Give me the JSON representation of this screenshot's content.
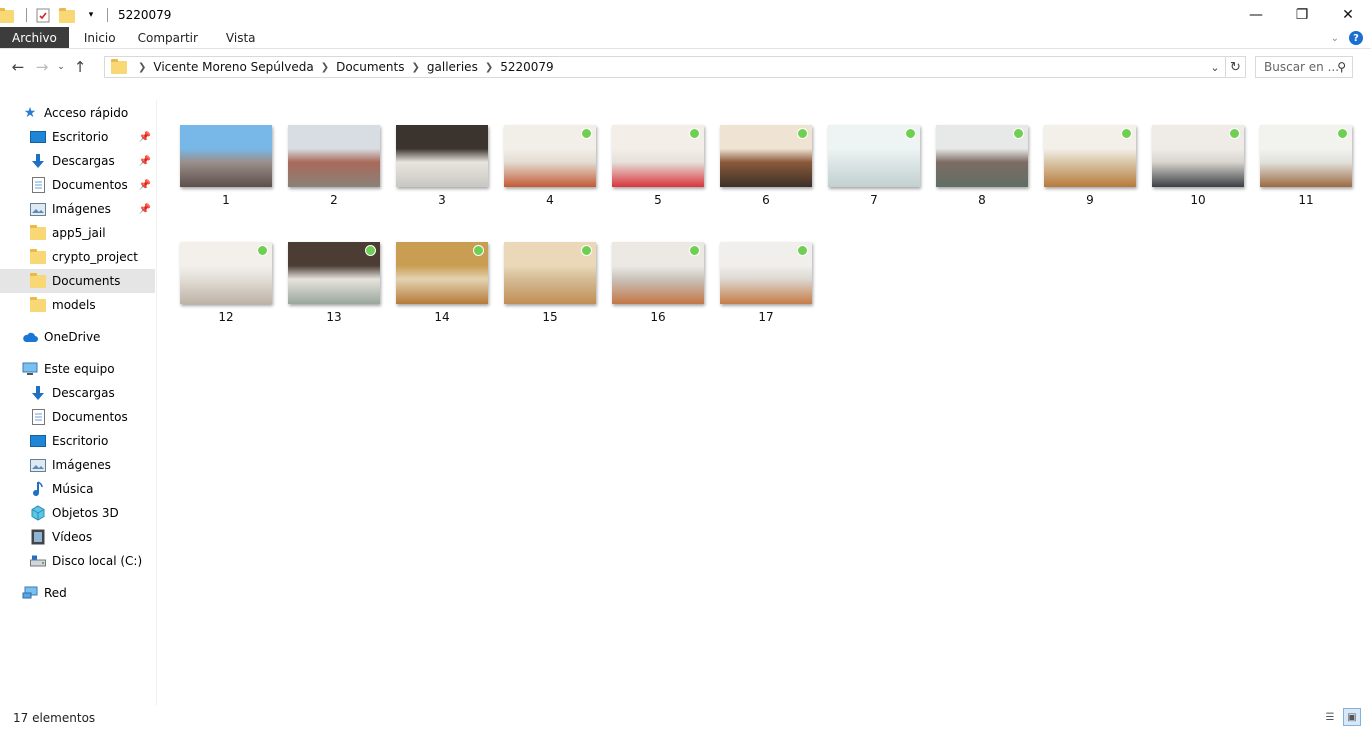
{
  "window": {
    "title": "5220079",
    "controls": {
      "minimize": "—",
      "maximize": "❐",
      "close": "✕"
    }
  },
  "ribbon": {
    "tabs": [
      "Archivo",
      "Inicio",
      "Compartir",
      "Vista"
    ],
    "help": "?"
  },
  "address": {
    "crumbs": [
      "Vicente Moreno Sepúlveda",
      "Documents",
      "galleries",
      "5220079"
    ]
  },
  "search": {
    "placeholder": "Buscar en ..."
  },
  "nav": {
    "quick_access": "Acceso rápido",
    "quick_items": [
      "Escritorio",
      "Descargas",
      "Documentos",
      "Imágenes",
      "app5_jail",
      "crypto_project",
      "Documents",
      "models"
    ],
    "onedrive": "OneDrive",
    "this_pc": "Este equipo",
    "pc_items": [
      "Descargas",
      "Documentos",
      "Escritorio",
      "Imágenes",
      "Música",
      "Objetos 3D",
      "Vídeos",
      "Disco local (C:)"
    ],
    "network": "Red"
  },
  "files": [
    {
      "label": "1",
      "colors": [
        "#78b8e8",
        "#9a8f8a",
        "#5d4f4b"
      ],
      "badge": false
    },
    {
      "label": "2",
      "colors": [
        "#d7dde3",
        "#a86a5a",
        "#8b8178"
      ],
      "badge": false
    },
    {
      "label": "3",
      "colors": [
        "#3b332e",
        "#e8e5df",
        "#c9c7c1"
      ],
      "badge": false
    },
    {
      "label": "4",
      "colors": [
        "#f2efe9",
        "#e3ddd3",
        "#c35a35"
      ],
      "badge": true
    },
    {
      "label": "5",
      "colors": [
        "#f3efe8",
        "#e6e1d9",
        "#d8343c"
      ],
      "badge": true
    },
    {
      "label": "6",
      "colors": [
        "#efe4d4",
        "#8a5a3a",
        "#3c3028"
      ],
      "badge": true
    },
    {
      "label": "7",
      "colors": [
        "#eef3f3",
        "#dde6e6",
        "#c2d1d0"
      ],
      "badge": true
    },
    {
      "label": "8",
      "colors": [
        "#e7e9e9",
        "#7d6c62",
        "#5f6f66"
      ],
      "badge": true
    },
    {
      "label": "9",
      "colors": [
        "#f3f0ea",
        "#d9c6a7",
        "#b77a3b"
      ],
      "badge": true
    },
    {
      "label": "10",
      "colors": [
        "#efece8",
        "#d8d4ce",
        "#3b3e45"
      ],
      "badge": true
    },
    {
      "label": "11",
      "colors": [
        "#f2f2ef",
        "#e1e1dc",
        "#9a6a42"
      ],
      "badge": true
    },
    {
      "label": "12",
      "colors": [
        "#f3f0ec",
        "#e2ddd6",
        "#bdb3a6"
      ],
      "badge": true
    },
    {
      "label": "13",
      "colors": [
        "#4b3c34",
        "#e6e3dc",
        "#9aa69c"
      ],
      "badge": true
    },
    {
      "label": "14",
      "colors": [
        "#c99e52",
        "#e3d2b1",
        "#b57a38"
      ],
      "badge": true
    },
    {
      "label": "15",
      "colors": [
        "#ead8b8",
        "#d4bb94",
        "#c18e55"
      ],
      "badge": true
    },
    {
      "label": "16",
      "colors": [
        "#ece9e5",
        "#c9c2ba",
        "#c47646"
      ],
      "badge": true
    },
    {
      "label": "17",
      "colors": [
        "#f1efec",
        "#dcd7d1",
        "#c67c47"
      ],
      "badge": true
    }
  ],
  "status": {
    "count": "17 elementos"
  }
}
